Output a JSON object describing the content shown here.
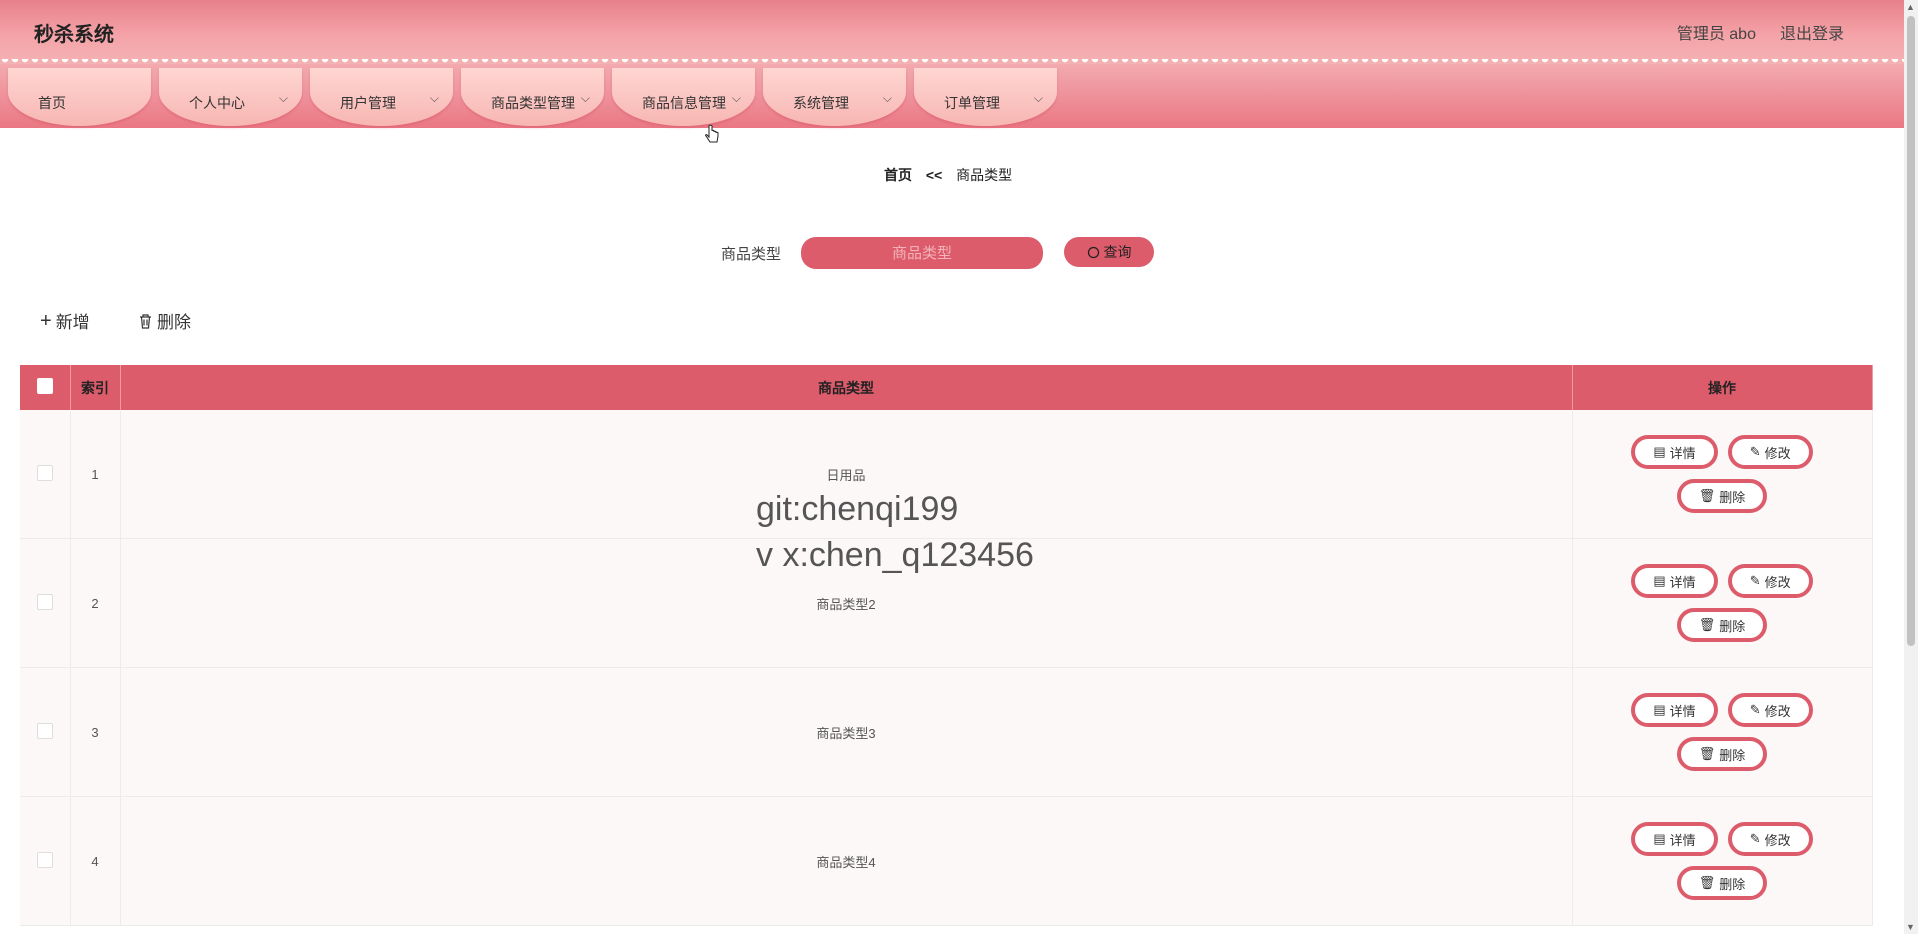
{
  "header": {
    "app_title": "秒杀系统",
    "user_label": "管理员 abo",
    "logout_label": "退出登录"
  },
  "nav": {
    "items": [
      {
        "label": "首页",
        "has_dropdown": false
      },
      {
        "label": "个人中心",
        "has_dropdown": true
      },
      {
        "label": "用户管理",
        "has_dropdown": true
      },
      {
        "label": "商品类型管理",
        "has_dropdown": true
      },
      {
        "label": "商品信息管理",
        "has_dropdown": true
      },
      {
        "label": "系统管理",
        "has_dropdown": true
      },
      {
        "label": "订单管理",
        "has_dropdown": true
      }
    ]
  },
  "breadcrumb": {
    "home": "首页",
    "separator": "<<",
    "current": "商品类型"
  },
  "search": {
    "label": "商品类型",
    "placeholder": "商品类型",
    "button_label": "查询"
  },
  "actions": {
    "add_label": "新增",
    "delete_label": "删除"
  },
  "table": {
    "columns": [
      "",
      "索引",
      "商品类型",
      "操作"
    ],
    "rows": [
      {
        "index": "1",
        "type": "日用品"
      },
      {
        "index": "2",
        "type": "商品类型2"
      },
      {
        "index": "3",
        "type": "商品类型3"
      },
      {
        "index": "4",
        "type": "商品类型4"
      }
    ],
    "row_ops": {
      "detail": "详情",
      "edit": "修改",
      "delete": "删除"
    }
  },
  "watermark": {
    "line1": "git:chenqi199",
    "line2": "v x:chen_q123456"
  },
  "colors": {
    "accent": "#dd5c6b",
    "header_top": "#e7808a",
    "nav_item": "#ffd6d3"
  }
}
